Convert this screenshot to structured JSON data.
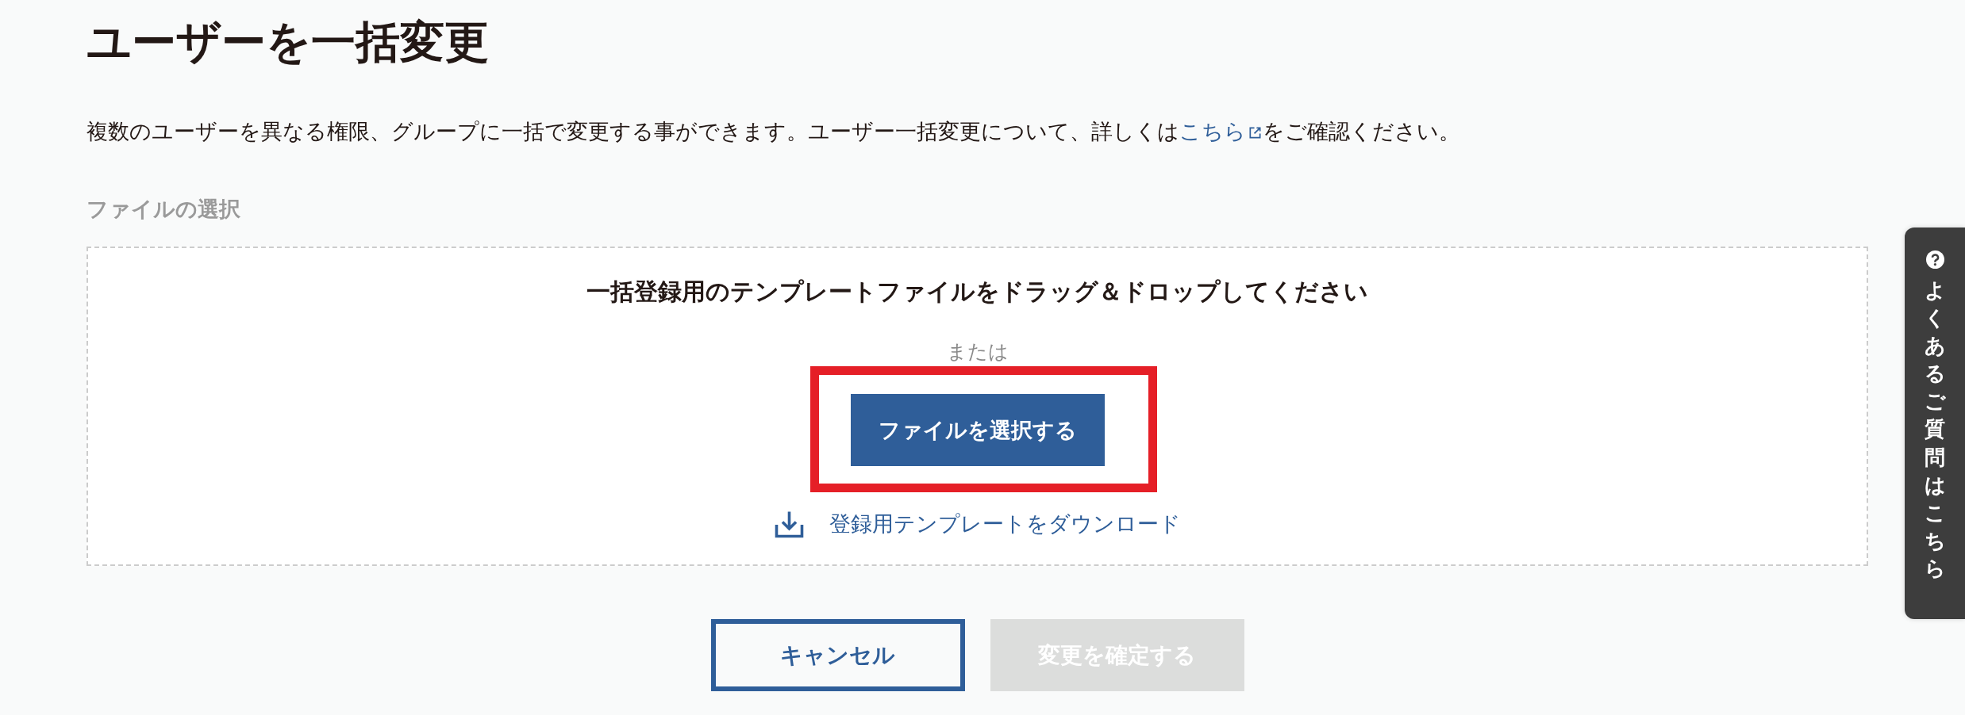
{
  "page": {
    "title": "ユーザーを一括変更",
    "description": {
      "text_before": "複数のユーザーを異なる権限、グループに一括で変更する事ができます。ユーザー一括変更について、詳しくは",
      "link": "こちら",
      "text_after": "をご確認ください。"
    }
  },
  "file_section": {
    "label": "ファイルの選択",
    "dropzone": {
      "heading": "一括登録用のテンプレートファイルをドラッグ＆ドロップしてください",
      "separator": "または",
      "select_button": {
        "label": "ファイルを選択する",
        "highlighted": true
      },
      "download_link": "登録用テンプレートをダウンロード"
    }
  },
  "actions": [
    {
      "label": "キャンセル",
      "kind": "outline",
      "disabled": false
    },
    {
      "label": "変更を確定する",
      "kind": "filled",
      "disabled": true
    }
  ],
  "help_tab": {
    "label": "よくあるご質問はこちら"
  }
}
